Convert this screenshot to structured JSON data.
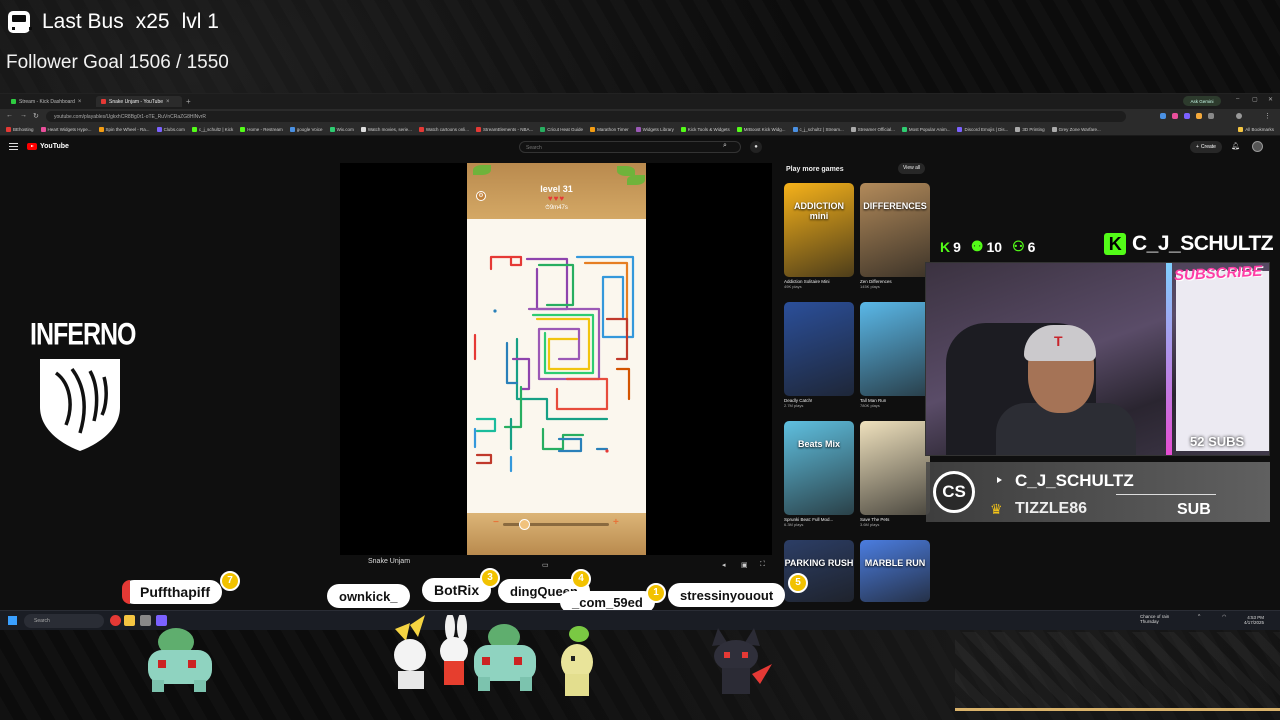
{
  "overlay": {
    "bus_title": "Last Bus",
    "multiplier": "x25",
    "level": "lvl 1",
    "follower_goal": "Follower Goal 1506 / 1550",
    "follower_goal_progress": 0.9716
  },
  "browser": {
    "tabs": [
      {
        "label": "Stream - Kick Dashboard",
        "active": false
      },
      {
        "label": "Snake Unjam - YouTube",
        "active": true
      }
    ],
    "new_tab": "+",
    "ask_gemini": "Ask Gemini",
    "url": "youtube.com/playables/UgkxhCR8Bg0r1-oTE_RuVnCRaZG8HlNvrR",
    "bookmarks": [
      "BEhosting",
      "Heart Widgets Hype...",
      "Spin the Wheel - Ra...",
      "Clubs.com",
      "c_j_schultz | Kick",
      "Home - Restream",
      "google Voice",
      "Wix.com",
      "Watch movies, serie...",
      "Watch cartoons onli...",
      "StreamElements - NBA...",
      "Cricut Heat Guide",
      "Marathon Timer",
      "Widgets Library",
      "Kick Tools & Widgets",
      "MrBoost Kick Widg...",
      "c_j_schultz | Stream...",
      "Streamer Official...",
      "Most Popular Anim...",
      "Discord Emojis | Dis...",
      "3D Printing",
      "Grey Zone Warfare...",
      "All Bookmarks"
    ]
  },
  "youtube": {
    "logo_text": "YouTube",
    "search_placeholder": "Search",
    "create_label": "Create",
    "video_title_peek": "Snake Unjam",
    "game": {
      "level": "level 31",
      "hearts": "♥♥♥",
      "timer": "⏱9m47s",
      "zoom_minus": "−",
      "zoom_plus": "+"
    },
    "more_games": {
      "heading": "Play more games",
      "view_all": "View all",
      "cards": [
        {
          "title": "Addiction Solitaire Mini",
          "plays": "49K plays",
          "thumb_text": "ADDICTION mini",
          "color": "#f6b21a"
        },
        {
          "title": "Zen Differences",
          "plays": "145K plays",
          "thumb_text": "DIFFERENCES",
          "color": "#b28a5a"
        },
        {
          "title": "Deadly Catch!",
          "plays": "2.7M plays",
          "thumb_text": "",
          "color": "#2b4f9a"
        },
        {
          "title": "Tall Man Run",
          "plays": "780K plays",
          "thumb_text": "",
          "color": "#5ab8e8"
        },
        {
          "title": "Sprunki Beat: Full Mod...",
          "plays": "6.3M plays",
          "thumb_text": "Beats Mix",
          "color": "#5fc0e0"
        },
        {
          "title": "Save The Pets",
          "plays": "3.6M plays",
          "thumb_text": "",
          "color": "#efe1bd"
        },
        {
          "title": "Parking Rush",
          "plays": "",
          "thumb_text": "PARKING RUSH",
          "color": "#2c3e66"
        },
        {
          "title": "Marble Run",
          "plays": "",
          "thumb_text": "MARBLE RUN",
          "color": "#4b7de0"
        }
      ]
    }
  },
  "streamer": {
    "kick_stats": [
      {
        "icon": "kick-icon",
        "value": "9"
      },
      {
        "icon": "viewer-icon",
        "value": "10"
      },
      {
        "icon": "follower-icon",
        "value": "6"
      }
    ],
    "kick_name": "C_J_SCHULTZ",
    "subscribe_sticker": "SUBSCRIBE",
    "subs_count": "52 SUBS",
    "cap_logo": "T",
    "alert": {
      "logo_text": "CS",
      "channel": "C_J_SCHULTZ",
      "gifter": "TIZZLE86",
      "type": "SUB"
    }
  },
  "team_logo": "INFERNO",
  "chat_pills": [
    {
      "name": "Puffthapiff",
      "badge": "7"
    },
    {
      "name": "ownkick_",
      "badge": ""
    },
    {
      "name": "BotRix",
      "badge": "3"
    },
    {
      "name": "dingQueen",
      "badge": "4"
    },
    {
      "name": "_com_59ed",
      "badge": "1"
    },
    {
      "name": "stressinyouout",
      "badge": "5"
    }
  ],
  "taskbar": {
    "search_placeholder": "Search",
    "weather": "Chance of rain",
    "weather_sub": "Thursday",
    "time": "4:53 PM",
    "date": "4/17/2025"
  },
  "colors": {
    "kick_green": "#53fc18",
    "youtube_red": "#ff0000",
    "badge_gold": "#f2c200",
    "browser_dark": "#0f0f0f"
  }
}
